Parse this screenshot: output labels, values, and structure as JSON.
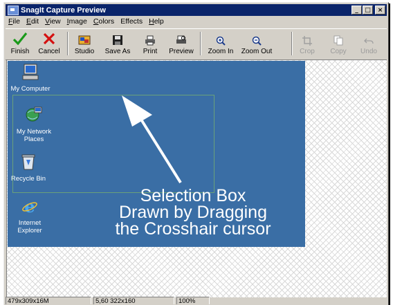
{
  "window": {
    "title": "SnagIt Capture Preview",
    "controls": {
      "minimize": "_",
      "maximize": "□",
      "close": "×"
    }
  },
  "menu": [
    {
      "label": "File",
      "key": "F",
      "rest": "ile"
    },
    {
      "label": "Edit",
      "key": "E",
      "rest": "dit"
    },
    {
      "label": "View",
      "key": "V",
      "rest": "iew"
    },
    {
      "label": "Image",
      "key": "I",
      "rest": "mage"
    },
    {
      "label": "Colors",
      "key": "C",
      "rest": "olors"
    },
    {
      "label": "Effects",
      "key": "",
      "rest": "Effects"
    },
    {
      "label": "Help",
      "key": "H",
      "rest": "elp"
    }
  ],
  "toolbar": {
    "finish": "Finish",
    "cancel": "Cancel",
    "studio": "Studio",
    "save_as": "Save As",
    "print": "Print",
    "preview": "Preview",
    "zoom_in": "Zoom In",
    "zoom_out": "Zoom Out",
    "crop": "Crop",
    "copy": "Copy",
    "undo": "Undo"
  },
  "desktop": {
    "my_computer": "My Computer",
    "my_network_line1": "My Network",
    "my_network_line2": "Places",
    "recycle_bin": "Recycle Bin",
    "ie_line1": "Internet",
    "ie_line2": "Explorer"
  },
  "annotation": {
    "line1": "Selection Box",
    "line2": "Drawn by Dragging",
    "line3": "the Crosshair cursor"
  },
  "status": {
    "image_info": "479x309x16M",
    "selection_info": "5,60 322x160",
    "zoom": "100%"
  },
  "colors": {
    "titlebar": "#0a246a",
    "desktop": "#3a6ea5",
    "chrome": "#d4d0c8"
  }
}
